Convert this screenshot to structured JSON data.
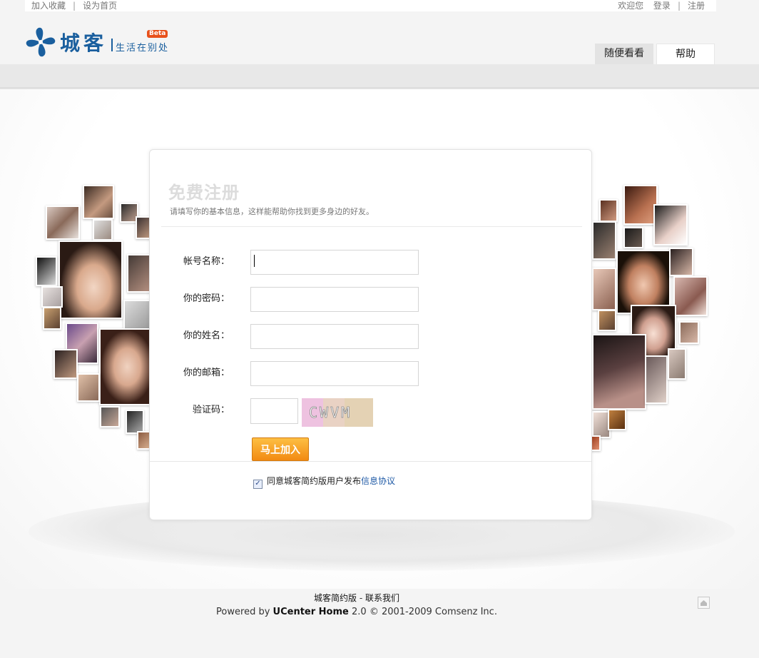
{
  "topbar": {
    "bookmark": "加入收藏",
    "set_home": "设为首页",
    "welcome": "欢迎您",
    "login": "登录",
    "register": "注册",
    "separator": "|"
  },
  "brand": {
    "name": "城客",
    "slogan": "生活在别处",
    "badge": "Beta",
    "color": "#1a5f9e"
  },
  "nav": {
    "tabs": [
      "随便看看",
      "帮助"
    ]
  },
  "form": {
    "title": "免费注册",
    "subtitle": "请填写你的基本信息，这样能帮助你找到更多身边的好友。",
    "fields": {
      "username": "帐号名称：",
      "password": "你的密码：",
      "realname": "你的姓名：",
      "email": "你的邮箱：",
      "captcha": "验证码："
    },
    "captcha_text": "CWVM",
    "submit_label": "马上加入",
    "agree_prefix": "同意城客简约版用户发布",
    "agree_link": "信息协议",
    "agree_checked": true,
    "accent": "#f28a12"
  },
  "footer": {
    "site_name": "城客简约版",
    "contact": "联系我们",
    "link_sep": " - ",
    "powered_prefix": "Powered by ",
    "product": "UCenter Home",
    "version": "2.0",
    "copyright": "© 2001-2009 Comsenz Inc."
  }
}
